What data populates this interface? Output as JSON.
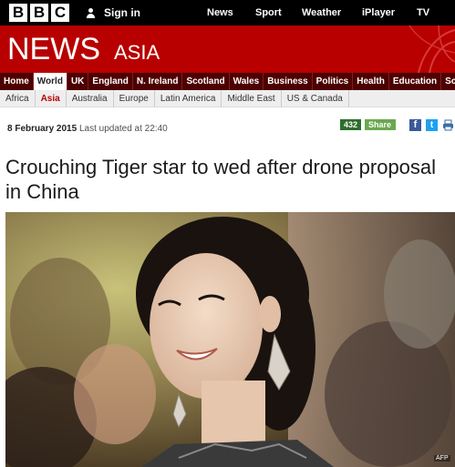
{
  "header": {
    "logo_letters": [
      "B",
      "B",
      "C"
    ],
    "signin_label": "Sign in",
    "nav": [
      "News",
      "Sport",
      "Weather",
      "iPlayer",
      "TV"
    ]
  },
  "banner": {
    "news_label": "NEWS",
    "region_label": "ASIA",
    "color": "#b80000"
  },
  "sections": [
    "Home",
    "World",
    "UK",
    "England",
    "N. Ireland",
    "Scotland",
    "Wales",
    "Business",
    "Politics",
    "Health",
    "Education",
    "Sci/E"
  ],
  "active_section": "World",
  "regions": [
    "Africa",
    "Asia",
    "Australia",
    "Europe",
    "Latin America",
    "Middle East",
    "US & Canada"
  ],
  "active_region": "Asia",
  "article": {
    "date": "8 February 2015",
    "updated": "Last updated at 22:40",
    "share_count": "432",
    "share_label": "Share",
    "social_icons": [
      "facebook-icon",
      "twitter-icon",
      "print-icon"
    ],
    "headline": "Crouching Tiger star to wed after drone proposal in China",
    "photo_credit": "AFP"
  }
}
